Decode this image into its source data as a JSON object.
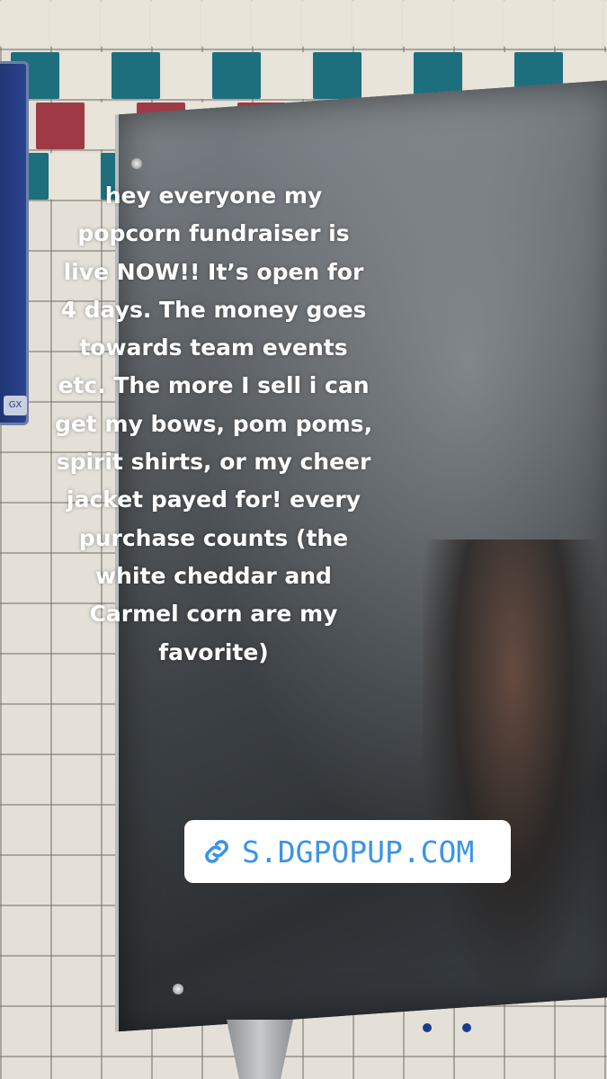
{
  "caption": {
    "lines": [
      "hey everyone my",
      "popcorn fundraiser is",
      "live NOW!! It’s open for",
      "4 days. The money goes",
      "towards team events",
      "etc. The more I sell i can",
      "get my bows, pom poms,",
      "spirit shirts, or my cheer",
      "jacket payed for! every",
      "purchase counts (the",
      "white cheddar and",
      "Carmel corn are my",
      "favorite)"
    ]
  },
  "link_sticker": {
    "icon": "link-icon",
    "text": "S.DGPOPUP.COM",
    "text_color": "#3a94e8",
    "background": "#ffffff"
  },
  "colors": {
    "tile_teal": "#1e6f7d",
    "tile_red": "#9e3a45",
    "panel_blue": "#2a448f"
  }
}
